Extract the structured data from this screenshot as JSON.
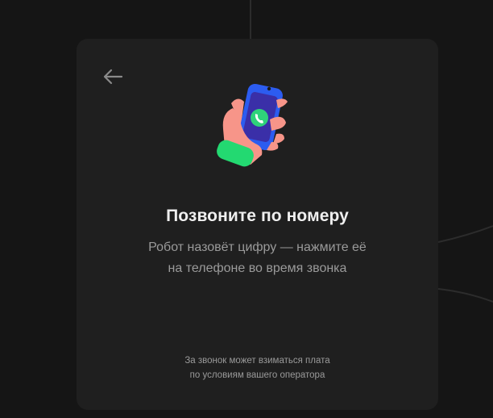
{
  "dialog": {
    "title": "Позвоните по номеру",
    "subtitle_line1": "Робот назовёт цифру — нажмите её",
    "subtitle_line2": "на телефоне во время звонка",
    "footnote_line1": "За звонок может взиматься плата",
    "footnote_line2": "по условиям вашего оператора"
  },
  "icons": {
    "back": "arrow-left-icon",
    "illustration": "hand-holding-phone-call-icon"
  },
  "colors": {
    "page_background": "#151515",
    "card_background": "#1f1f1f",
    "title_text": "#efefef",
    "secondary_text": "#9a9a9a",
    "phone_blue": "#2c5cf0",
    "call_green": "#2fd37a",
    "hand_pink": "#f79589",
    "cuff_green": "#23d971"
  }
}
